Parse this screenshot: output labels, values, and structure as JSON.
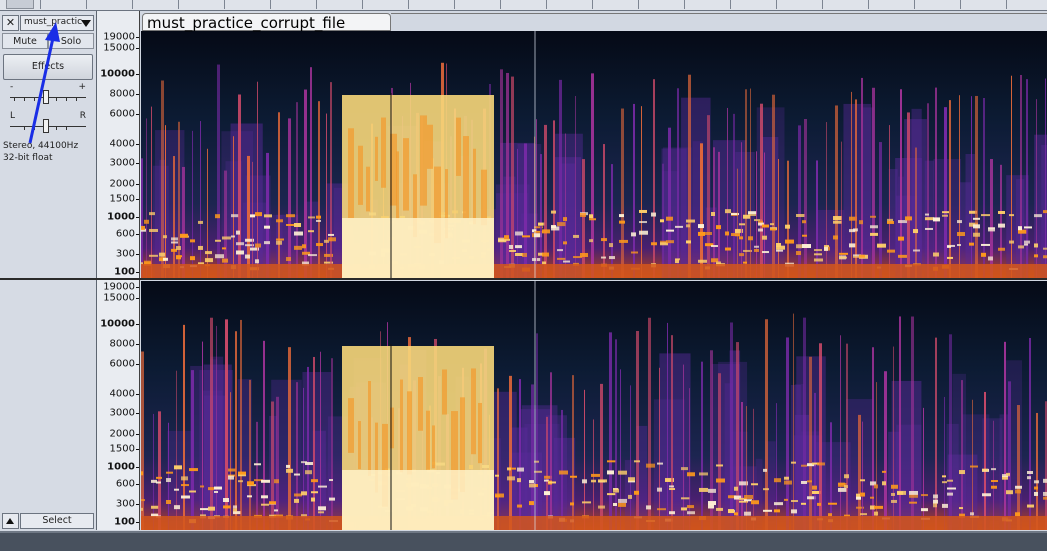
{
  "track": {
    "name": "must_practic",
    "title": "must_practice_corrupt_file",
    "close_symbol": "✕",
    "mute_label": "Mute",
    "solo_label": "Solo",
    "effects_label": "Effects",
    "gain_minus": "-",
    "gain_plus": "+",
    "pan_left": "L",
    "pan_right": "R",
    "info_line1": "Stereo, 44100Hz",
    "info_line2": "32-bit float",
    "select_label": "Select"
  },
  "frequency_scale": {
    "ticks": [
      "19000",
      "15000",
      "10000",
      "8000",
      "6000",
      "4000",
      "3000",
      "2000",
      "1500",
      "1000",
      "600",
      "300",
      "100"
    ],
    "bold_ticks": [
      "10000",
      "1000",
      "100"
    ]
  },
  "colors": {
    "spectrogram_low": "#0c1526",
    "spectrogram_mid": "#7a2aa8",
    "spectrogram_high": "#ff9a1a",
    "spectrogram_peak": "#fff3d6",
    "selection": "#f7d77a",
    "annotation_arrow": "#1a2ee6"
  },
  "icons": {
    "close": "close-icon",
    "dropdown": "chevron-down-icon",
    "collapse": "collapse-up-icon"
  }
}
